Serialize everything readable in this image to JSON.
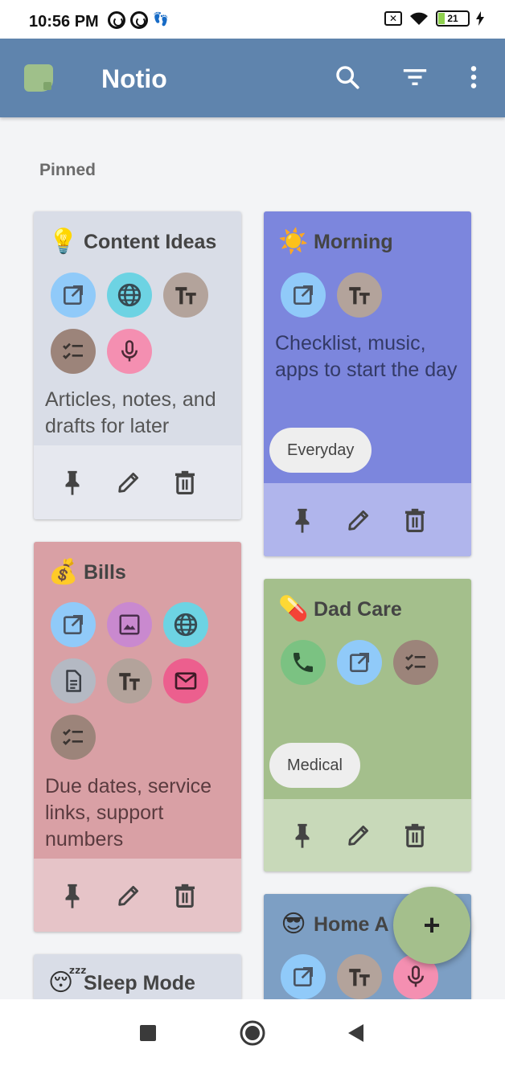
{
  "status_bar": {
    "time": "10:56 PM",
    "battery_level": "21",
    "icons": [
      "at-sign-icon",
      "at-sign-icon",
      "footsteps-icon",
      "sim-x-icon",
      "wifi-icon",
      "battery-icon",
      "charging-icon"
    ]
  },
  "app_bar": {
    "title": "Notio",
    "color": "#5f84ad",
    "actions": [
      "search-icon",
      "filter-icon",
      "more-vert-icon"
    ]
  },
  "section": {
    "label": "Pinned"
  },
  "cards": [
    {
      "emoji": "💡",
      "title": "Content Ideas",
      "chips": [
        "open-link-icon",
        "globe-icon",
        "text-icon",
        "checklist-icon",
        "microphone-icon"
      ],
      "description": "Articles, notes, and drafts for later",
      "tag": "",
      "color": "#d9dde7"
    },
    {
      "emoji": "☀️",
      "title": "Morning",
      "chips": [
        "open-link-icon",
        "text-icon"
      ],
      "description": "Checklist, music, apps to start the day",
      "tag": "Everyday",
      "color": "#7c86dd"
    },
    {
      "emoji": "💰",
      "title": "Bills",
      "chips": [
        "open-link-icon",
        "image-icon",
        "globe-icon",
        "document-icon",
        "text-icon",
        "email-icon",
        "checklist-icon"
      ],
      "description": "Due dates, service links, support numbers",
      "tag": "",
      "color": "#d9a0a5"
    },
    {
      "emoji": "💊",
      "title": "Dad Care",
      "chips": [
        "phone-icon",
        "open-link-icon",
        "checklist-icon"
      ],
      "description": "",
      "tag": "Medical",
      "color": "#a4bf8c"
    },
    {
      "emoji": "😎",
      "title": "Home A",
      "chips": [
        "open-link-icon",
        "text-icon",
        "microphone-icon"
      ],
      "description": "",
      "tag": "",
      "color": "#7d9fc4"
    },
    {
      "emoji": "😴",
      "title": "Sleep Mode",
      "chips": [],
      "description": "",
      "tag": "",
      "color": "#d9dde7"
    }
  ],
  "card_actions": [
    "pin-icon",
    "edit-icon",
    "delete-icon"
  ],
  "fab": {
    "label": "+"
  },
  "nav_bar": {
    "buttons": [
      "recents-icon",
      "home-icon",
      "back-icon"
    ]
  }
}
